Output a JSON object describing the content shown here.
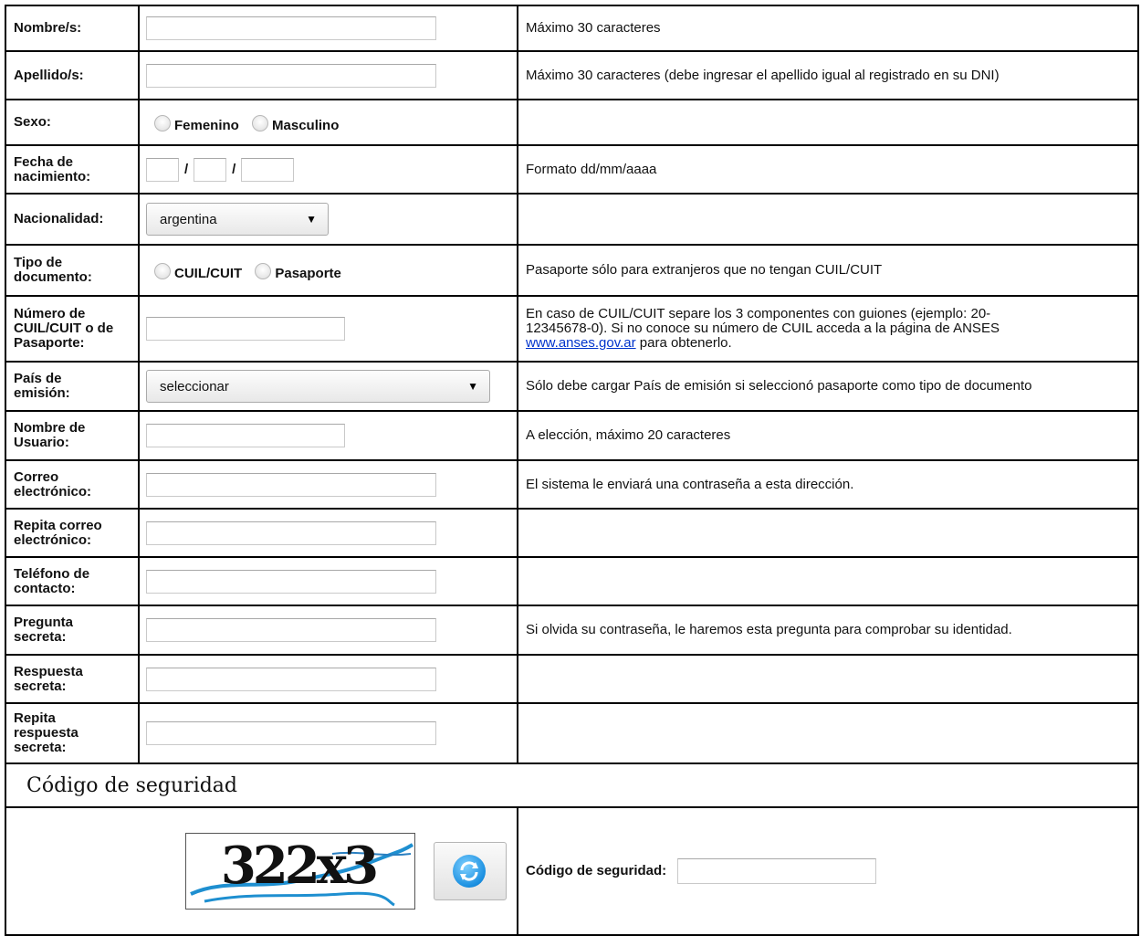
{
  "rows": {
    "nombre": {
      "label": "Nombre/s:",
      "hint": "Máximo 30 caracteres"
    },
    "apellido": {
      "label": "Apellido/s:",
      "hint": "Máximo 30 caracteres (debe ingresar el apellido igual al registrado en su DNI)"
    },
    "sexo": {
      "label": "Sexo:",
      "options": [
        "Femenino",
        "Masculino"
      ]
    },
    "fecha": {
      "label_1": "Fecha de",
      "label_2": "nacimiento:",
      "sep": "/",
      "hint": "Formato dd/mm/aaaa"
    },
    "nacionalidad": {
      "label": "Nacionalidad:",
      "value": "argentina"
    },
    "tipo_doc": {
      "label_1": "Tipo de",
      "label_2": "documento:",
      "options": [
        "CUIL/CUIT",
        "Pasaporte"
      ],
      "hint": "Pasaporte sólo para extranjeros que no tengan CUIL/CUIT"
    },
    "numero": {
      "label_1": "Número de",
      "label_2": "CUIL/CUIT o de",
      "label_3": "Pasaporte:",
      "hint_1": "En caso de CUIL/CUIT separe los 3 componentes con guiones (ejemplo: 20-",
      "hint_2": "12345678-0). Si no conoce su número de CUIL acceda a la página de ANSES",
      "link": "www.anses.gov.ar",
      "hint_3": " para obtenerlo."
    },
    "pais": {
      "label_1": "País de",
      "label_2": "emisión:",
      "value": "seleccionar",
      "hint": "Sólo debe cargar País de emisión si seleccionó pasaporte como tipo de documento"
    },
    "usuario": {
      "label_1": "Nombre de",
      "label_2": "Usuario:",
      "hint": "A elección, máximo 20 caracteres"
    },
    "correo": {
      "label_1": "Correo",
      "label_2": "electrónico:",
      "hint": "El sistema le enviará una contraseña a esta dirección."
    },
    "repita_correo": {
      "label_1": "Repita correo",
      "label_2": "electrónico:"
    },
    "telefono": {
      "label_1": "Teléfono de",
      "label_2": "contacto:"
    },
    "pregunta": {
      "label_1": "Pregunta",
      "label_2": "secreta:",
      "hint": "Si olvida su contraseña, le haremos esta pregunta para comprobar su identidad."
    },
    "respuesta": {
      "label_1": "Respuesta",
      "label_2": "secreta:"
    },
    "repita_respuesta": {
      "label_1": "Repita",
      "label_2": "respuesta",
      "label_3": "secreta:"
    }
  },
  "section": {
    "title": "Código de seguridad"
  },
  "captcha": {
    "text": "322x3",
    "label": "Código de seguridad:",
    "refresh_icon": "refresh-icon"
  },
  "colors": {
    "border": "#000000",
    "link": "#0033cc",
    "refresh": "#1a8fe0",
    "captcha_line": "#1e8fd0"
  }
}
